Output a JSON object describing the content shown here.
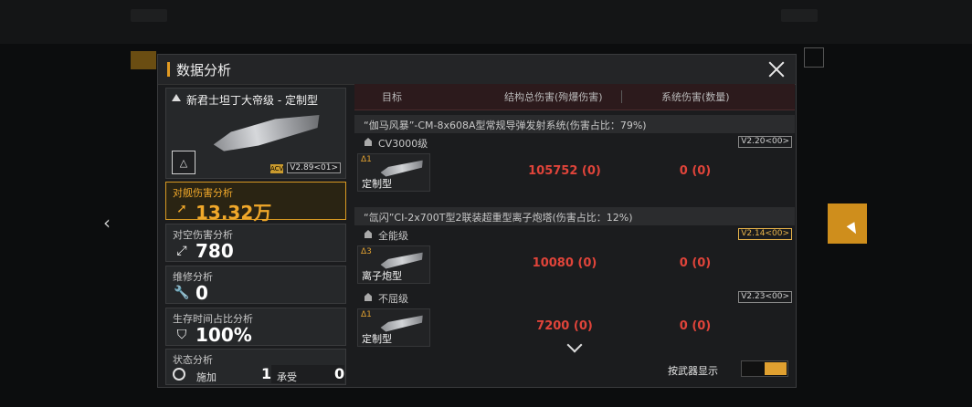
{
  "modal": {
    "title": "数据分析"
  },
  "ship": {
    "name": "新君士坦丁大帝级 - 定制型",
    "version": "V2.89<01>",
    "version_tag": "ACV"
  },
  "stats": [
    {
      "label": "对舰伤害分析",
      "value": "13.32万",
      "icon": "arrow-up-right-icon",
      "active": true
    },
    {
      "label": "对空伤害分析",
      "value": "780",
      "icon": "anti-air-icon",
      "active": false
    },
    {
      "label": "维修分析",
      "value": "0",
      "icon": "wrench-icon",
      "active": false
    },
    {
      "label": "生存时间占比分析",
      "value": "100%",
      "icon": "shield-icon",
      "active": false
    }
  ],
  "status": {
    "label": "状态分析",
    "apply_label": "施加",
    "apply_value": "1",
    "receive_label": "承受",
    "receive_value": "0"
  },
  "table": {
    "headers": [
      "目标",
      "结构总伤害(殉爆伤害)",
      "系统伤害(数量)"
    ],
    "weapons": [
      {
        "name": "“伽马风暴”-CM-8x608A型常规导弹发射系统(伤害占比：79%)",
        "grades": [
          {
            "label": "CV3000级",
            "version": "V2.20<00>",
            "gold": false,
            "rows": [
              {
                "tag": "Δ1",
                "label": "定制型",
                "struct": "105752 (0)",
                "sys": "0 (0)"
              }
            ]
          }
        ]
      },
      {
        "name": "“氙闪”CI-2x700T型2联装超重型离子炮塔(伤害占比：12%)",
        "grades": [
          {
            "label": "全能级",
            "version": "V2.14<00>",
            "gold": true,
            "rows": [
              {
                "tag": "Δ3",
                "label": "离子炮型",
                "struct": "10080 (0)",
                "sys": "0 (0)"
              }
            ]
          },
          {
            "label": "不屈级",
            "version": "V2.23<00>",
            "gold": false,
            "rows": [
              {
                "tag": "Δ1",
                "label": "定制型",
                "struct": "7200 (0)",
                "sys": "0 (0)"
              }
            ]
          }
        ]
      }
    ]
  },
  "toggle": {
    "label": "按武器显示",
    "on": true
  },
  "colors": {
    "accent": "#e0a030",
    "damage": "#e0443a"
  }
}
